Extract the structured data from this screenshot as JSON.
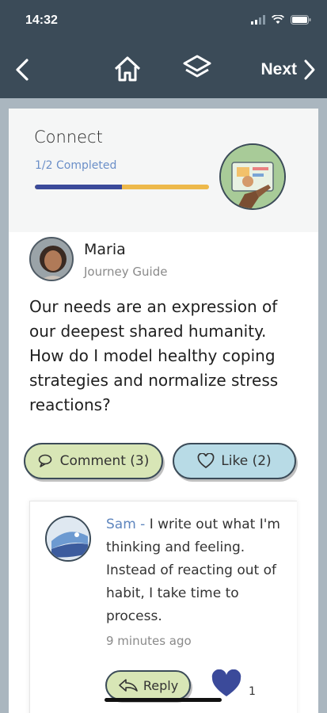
{
  "status_bar": {
    "time": "14:32"
  },
  "nav": {
    "next_label": "Next"
  },
  "section": {
    "title": "Connect",
    "progress_text": "1/2 Completed",
    "progress_fraction": 0.5
  },
  "post": {
    "author_name": "Maria",
    "author_role": "Journey Guide",
    "text": "Our needs are an expression of our deepest shared humanity. How do I model healthy coping strategies and normalize stress reactions?",
    "comment_button": "Comment (3)",
    "like_button": "Like (2)"
  },
  "comment": {
    "author": "Sam",
    "separator": " - ",
    "text": "I write out what I'm thinking and feeling. Instead of reacting out of habit, I take time to process.",
    "time": "9 minutes ago",
    "reply_label": "Reply",
    "like_count": "1"
  },
  "colors": {
    "header_bg": "#3b4b58",
    "progress_done": "#3b4a9a",
    "progress_remaining": "#edb94b",
    "comment_btn": "#d8e6b6",
    "like_btn": "#b8dbe6",
    "author_link": "#5f86be"
  },
  "icons": [
    "back-chevron-icon",
    "home-icon",
    "layers-icon",
    "forward-chevron-icon",
    "comment-icon",
    "heart-outline-icon",
    "reply-icon",
    "heart-filled-icon"
  ]
}
